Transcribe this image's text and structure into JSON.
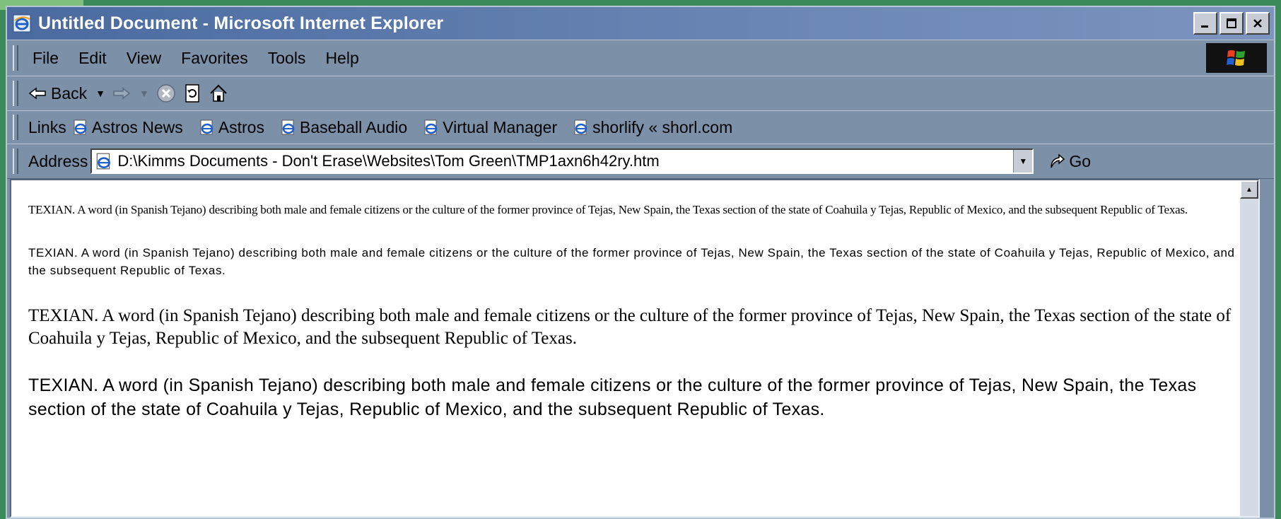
{
  "window": {
    "title": "Untitled Document - Microsoft Internet Explorer"
  },
  "menubar": {
    "items": [
      "File",
      "Edit",
      "View",
      "Favorites",
      "Tools",
      "Help"
    ]
  },
  "navbar": {
    "back_label": "Back"
  },
  "links": {
    "label": "Links",
    "items": [
      "Astros News",
      "Astros",
      "Baseball Audio",
      "Virtual Manager",
      "shorlify « shorl.com"
    ]
  },
  "address": {
    "label": "Address",
    "value": "D:\\Kimms Documents - Don't Erase\\Websites\\Tom Green\\TMP1axn6h42ry.htm",
    "go_label": "Go"
  },
  "document": {
    "paragraphs": [
      "TEXIAN. A word (in Spanish Tejano) describing both male and female citizens or the culture of the former province of Tejas, New Spain, the Texas section of the state of Coahuila y Tejas, Republic of Mexico, and the subsequent Republic of Texas.",
      "TEXIAN. A word (in Spanish Tejano) describing both male and female citizens or the culture of the former province of Tejas, New Spain, the Texas section of the state of Coahuila y Tejas, Republic of Mexico, and the subsequent Republic of Texas.",
      "TEXIAN. A word (in Spanish Tejano) describing both male and female citizens or the culture of the former province of Tejas, New Spain, the Texas section of the state of Coahuila y Tejas, Republic of Mexico, and the subsequent Republic of Texas.",
      "TEXIAN. A word (in Spanish Tejano) describing both male and female citizens or the culture of the former province of Tejas, New Spain, the Texas section of the state of Coahuila y Tejas, Republic of Mexico, and the subsequent Republic of Texas."
    ]
  },
  "icons": {
    "app": "ie-logo-icon",
    "links": "ie-page-icon",
    "go": "go-arrow-icon"
  },
  "colors": {
    "titlebar": "#4a6aa0",
    "chrome": "#7c90a8",
    "content_bg": "#ffffff"
  }
}
